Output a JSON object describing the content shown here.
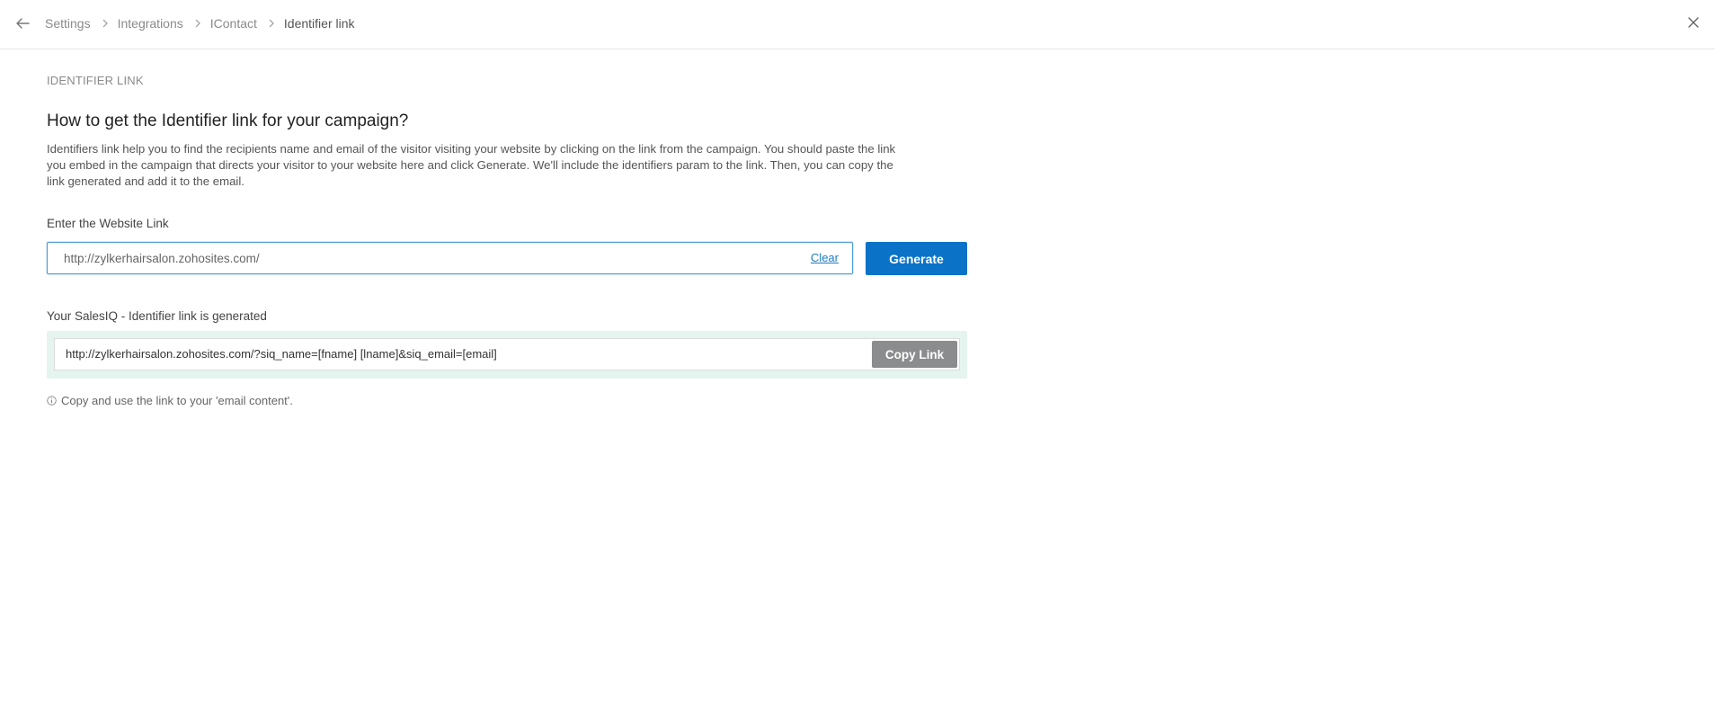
{
  "breadcrumb": {
    "items": [
      {
        "label": "Settings"
      },
      {
        "label": "Integrations"
      },
      {
        "label": "IContact"
      },
      {
        "label": "Identifier link"
      }
    ]
  },
  "icons": {
    "back": "arrow-left-icon",
    "separator": "chevron-right-icon",
    "close": "close-icon",
    "info": "info-circle-icon"
  },
  "page": {
    "section_label": "IDENTIFIER LINK",
    "heading": "How to get the Identifier link for your campaign?",
    "description": "Identifiers link help you to find the recipients name and email of the visitor visiting your website by clicking on the link from the campaign. You should paste the link you embed in the campaign that directs your visitor to your website here and click Generate. We'll include the identifiers param to the link. Then, you can copy the link generated and add it to the email."
  },
  "website_link": {
    "label": "Enter the Website Link",
    "value": "http://zylkerhairsalon.zohosites.com/",
    "clear_label": "Clear",
    "generate_label": "Generate"
  },
  "generated": {
    "label": "Your SalesIQ - Identifier link is generated",
    "url": "http://zylkerhairsalon.zohosites.com/?siq_name=[fname] [lname]&siq_email=[email]",
    "copy_label": "Copy Link",
    "hint": "Copy and use the link to your 'email content'."
  },
  "colors": {
    "primary": "#0a73c8",
    "success_bg": "#e5f4ee",
    "disabled_btn": "#8a8c8e"
  }
}
